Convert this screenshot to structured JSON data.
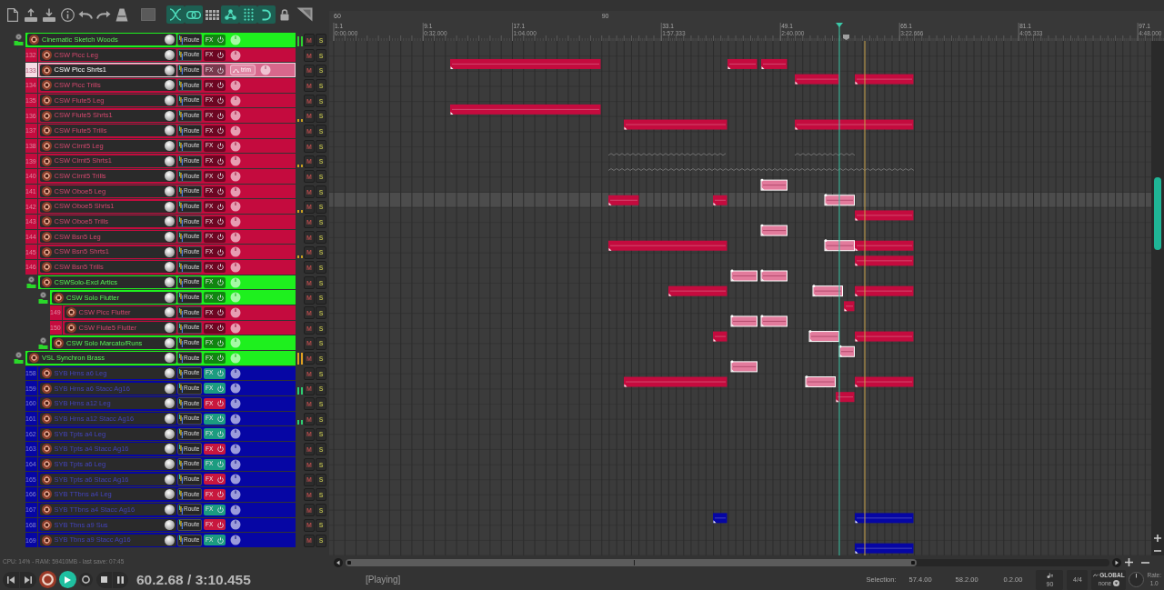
{
  "toolbar": {
    "toggles": [
      {
        "on": true
      },
      {
        "on": true
      },
      {
        "on": false
      },
      {
        "on": true
      },
      {
        "on": true
      },
      {
        "on": true
      },
      {
        "on": false
      }
    ]
  },
  "tracks": [
    {
      "kind": "folder",
      "name": "Cinematic Sketch Woods",
      "color": "#1ef01e",
      "selected": false,
      "route": "Route",
      "fx": {
        "label": "FX",
        "kind": "empty"
      },
      "mute": "M",
      "solo": "S",
      "meter": {
        "level": 0.8,
        "color": "#2ed12e"
      },
      "children": [
        {
          "kind": "track",
          "number": "132",
          "name": "CSW Picc Leg",
          "color": "#c40b3e",
          "selected": false,
          "route": "Route",
          "fx": {
            "label": "FX",
            "kind": "empty"
          },
          "mute": "M",
          "solo": "S"
        },
        {
          "kind": "track",
          "number": "133",
          "name": "CSW Picc Shrts1",
          "color": "#d8678c",
          "selected": true,
          "route": "Route",
          "fx": {
            "label": "FX",
            "kind": "empty"
          },
          "trim": "trim",
          "mute": "M",
          "solo": "S"
        },
        {
          "kind": "track",
          "number": "134",
          "name": "CSW Picc Trills",
          "color": "#c40b3e",
          "selected": false,
          "route": "Route",
          "fx": {
            "label": "FX",
            "kind": "empty"
          },
          "mute": "M",
          "solo": "S"
        },
        {
          "kind": "track",
          "number": "135",
          "name": "CSW Flute5 Leg",
          "color": "#c40b3e",
          "selected": false,
          "route": "Route",
          "fx": {
            "label": "FX",
            "kind": "empty"
          },
          "mute": "M",
          "solo": "S"
        },
        {
          "kind": "track",
          "number": "136",
          "name": "CSW Flute5 Shrts1",
          "color": "#c40b3e",
          "selected": false,
          "route": "Route",
          "fx": {
            "label": "FX",
            "kind": "empty"
          },
          "mute": "M",
          "solo": "S",
          "meter": {
            "level": 0.25,
            "color": "#c8a020"
          }
        },
        {
          "kind": "track",
          "number": "137",
          "name": "CSW Flute5 Trills",
          "color": "#c40b3e",
          "selected": false,
          "route": "Route",
          "fx": {
            "label": "FX",
            "kind": "empty"
          },
          "mute": "M",
          "solo": "S"
        },
        {
          "kind": "track",
          "number": "138",
          "name": "CSW Clrnt5 Leg",
          "color": "#c40b3e",
          "selected": false,
          "route": "Route",
          "fx": {
            "label": "FX",
            "kind": "empty"
          },
          "mute": "M",
          "solo": "S"
        },
        {
          "kind": "track",
          "number": "139",
          "name": "CSW Clrnt5 Shrts1",
          "color": "#c40b3e",
          "selected": false,
          "route": "Route",
          "fx": {
            "label": "FX",
            "kind": "empty"
          },
          "mute": "M",
          "solo": "S",
          "meter": {
            "level": 0.25,
            "color": "#c8a020"
          }
        },
        {
          "kind": "track",
          "number": "140",
          "name": "CSW Clrnt5 Trills",
          "color": "#c40b3e",
          "selected": false,
          "route": "Route",
          "fx": {
            "label": "FX",
            "kind": "empty"
          },
          "mute": "M",
          "solo": "S"
        },
        {
          "kind": "track",
          "number": "141",
          "name": "CSW Oboe5 Leg",
          "color": "#c40b3e",
          "selected": false,
          "route": "Route",
          "fx": {
            "label": "FX",
            "kind": "empty"
          },
          "mute": "M",
          "solo": "S"
        },
        {
          "kind": "track",
          "number": "142",
          "name": "CSW Oboe5 Shrts1",
          "color": "#c40b3e",
          "selected": false,
          "route": "Route",
          "fx": {
            "label": "FX",
            "kind": "empty"
          },
          "mute": "M",
          "solo": "S",
          "meter": {
            "level": 0.25,
            "color": "#c8a020"
          }
        },
        {
          "kind": "track",
          "number": "143",
          "name": "CSW Oboe5 Trills",
          "color": "#c40b3e",
          "selected": false,
          "route": "Route",
          "fx": {
            "label": "FX",
            "kind": "empty"
          },
          "mute": "M",
          "solo": "S"
        },
        {
          "kind": "track",
          "number": "144",
          "name": "CSW Bsn5 Leg",
          "color": "#c40b3e",
          "selected": false,
          "route": "Route",
          "fx": {
            "label": "FX",
            "kind": "empty"
          },
          "mute": "M",
          "solo": "S"
        },
        {
          "kind": "track",
          "number": "145",
          "name": "CSW Bsn5 Shrts1",
          "color": "#c40b3e",
          "selected": false,
          "route": "Route",
          "fx": {
            "label": "FX",
            "kind": "empty"
          },
          "mute": "M",
          "solo": "S",
          "meter": {
            "level": 0.25,
            "color": "#c8a020"
          }
        },
        {
          "kind": "track",
          "number": "146",
          "name": "CSW Bsn5 Trills",
          "color": "#c40b3e",
          "selected": false,
          "route": "Route",
          "fx": {
            "label": "FX",
            "kind": "empty"
          },
          "mute": "M",
          "solo": "S"
        },
        {
          "kind": "folder",
          "name": "CSWSolo-Excl Artics",
          "color": "#1ef01e",
          "selected": false,
          "route": "Route",
          "fx": {
            "label": "FX",
            "kind": "empty"
          },
          "mute": "M",
          "solo": "S",
          "children": [
            {
              "kind": "folder",
              "name": "CSW Solo Flutter",
              "color": "#1ef01e",
              "selected": false,
              "route": "Route",
              "fx": {
                "label": "FX",
                "kind": "empty"
              },
              "mute": "M",
              "solo": "S",
              "children": [
                {
                  "kind": "track",
                  "number": "149",
                  "name": "CSW Picc Flutter",
                  "color": "#c40b3e",
                  "selected": false,
                  "route": "Route",
                  "fx": {
                    "label": "FX",
                    "kind": "empty"
                  },
                  "mute": "M",
                  "solo": "S"
                },
                {
                  "kind": "track",
                  "number": "150",
                  "name": "CSW Flute5 Flutter",
                  "color": "#c40b3e",
                  "selected": false,
                  "route": "Route",
                  "fx": {
                    "label": "FX",
                    "kind": "empty"
                  },
                  "mute": "M",
                  "solo": "S"
                }
              ]
            },
            {
              "kind": "folder",
              "name": "CSW Solo Marcato/Runs",
              "color": "#1ef01e",
              "selected": false,
              "route": "Route",
              "fx": {
                "label": "FX",
                "kind": "empty"
              },
              "mute": "M",
              "solo": "S"
            }
          ]
        }
      ]
    },
    {
      "kind": "folder",
      "name": "VSL Synchron Brass",
      "color": "#1ef01e",
      "selected": false,
      "route": "Route",
      "fx": {
        "label": "FX",
        "kind": "empty"
      },
      "mute": "M",
      "solo": "S",
      "meter": {
        "level": 0.9,
        "color": "#e0a020"
      },
      "children": [
        {
          "kind": "track",
          "number": "158",
          "name": "SYB Hrns a6 Leg",
          "color": "#0606a4",
          "selected": false,
          "route": "Route",
          "fx": {
            "label": "FX",
            "kind": "active"
          },
          "mute": "M",
          "solo": "S"
        },
        {
          "kind": "track",
          "number": "159",
          "name": "SYB Hrns a6 Stacc Ag16",
          "color": "#0606a4",
          "selected": false,
          "route": "Route",
          "fx": {
            "label": "FX",
            "kind": "active"
          },
          "mute": "M",
          "solo": "S",
          "meter": {
            "level": 0.6,
            "color": "#2ecc71"
          }
        },
        {
          "kind": "track",
          "number": "160",
          "name": "SYB Hrns a12 Leg",
          "color": "#0606a4",
          "selected": false,
          "route": "Route",
          "fx": {
            "label": "FX",
            "kind": "bypassed"
          },
          "mute": "M",
          "solo": "S"
        },
        {
          "kind": "track",
          "number": "161",
          "name": "SYB Hrns a12 Stacc Ag16",
          "color": "#0606a4",
          "selected": false,
          "route": "Route",
          "fx": {
            "label": "FX",
            "kind": "active"
          },
          "mute": "M",
          "solo": "S",
          "meter": {
            "level": 0.4,
            "color": "#2ecc71"
          }
        },
        {
          "kind": "track",
          "number": "162",
          "name": "SYB Tpts a4 Leg",
          "color": "#0606a4",
          "selected": false,
          "route": "Route",
          "fx": {
            "label": "FX",
            "kind": "active"
          },
          "mute": "M",
          "solo": "S"
        },
        {
          "kind": "track",
          "number": "163",
          "name": "SYB Tpts a4 Stacc Ag16",
          "color": "#0606a4",
          "selected": false,
          "route": "Route",
          "fx": {
            "label": "FX",
            "kind": "bypassed"
          },
          "mute": "M",
          "solo": "S"
        },
        {
          "kind": "track",
          "number": "164",
          "name": "SYB Tpts a6 Leg",
          "color": "#0606a4",
          "selected": false,
          "route": "Route",
          "fx": {
            "label": "FX",
            "kind": "active"
          },
          "mute": "M",
          "solo": "S"
        },
        {
          "kind": "track",
          "number": "165",
          "name": "SYB Tpts a6 Stacc Ag16",
          "color": "#0606a4",
          "selected": false,
          "route": "Route",
          "fx": {
            "label": "FX",
            "kind": "bypassed"
          },
          "mute": "M",
          "solo": "S"
        },
        {
          "kind": "track",
          "number": "166",
          "name": "SYB TTbns a4 Leg",
          "color": "#0606a4",
          "selected": false,
          "route": "Route",
          "fx": {
            "label": "FX",
            "kind": "bypassed"
          },
          "mute": "M",
          "solo": "S"
        },
        {
          "kind": "track",
          "number": "167",
          "name": "SYB TTbns a4 Stacc Ag16",
          "color": "#0606a4",
          "selected": false,
          "route": "Route",
          "fx": {
            "label": "FX",
            "kind": "active"
          },
          "mute": "M",
          "solo": "S"
        },
        {
          "kind": "track",
          "number": "168",
          "name": "SYB Tbns a9 Sus",
          "color": "#0606a4",
          "selected": false,
          "route": "Route",
          "fx": {
            "label": "FX",
            "kind": "bypassed"
          },
          "mute": "M",
          "solo": "S"
        },
        {
          "kind": "track",
          "number": "169",
          "name": "SYB Tbns a9 Stacc Ag16",
          "color": "#0606a4",
          "selected": false,
          "route": "Route",
          "fx": {
            "label": "FX",
            "kind": "active"
          },
          "mute": "M",
          "solo": "S"
        }
      ]
    }
  ],
  "status_line": "CPU: 14% - RAM: 59410MB - last save: 07:45",
  "ruler": {
    "tempo_markers": [
      {
        "bpm": "60"
      },
      {
        "bpm": "90"
      }
    ],
    "marks": [
      {
        "bar": "1.1",
        "time": "0:00.000"
      },
      {
        "bar": "9.1",
        "time": "0:32.000"
      },
      {
        "bar": "17.1",
        "time": "1:04.000"
      },
      {
        "bar": "33.1",
        "time": "1:57.333"
      },
      {
        "bar": "49.1",
        "time": "2:40.000"
      },
      {
        "bar": "65.1",
        "time": "3:22.666"
      },
      {
        "bar": "81.1",
        "time": "4:05.333"
      },
      {
        "bar": "97.1",
        "time": "4:48.000"
      }
    ]
  },
  "arrange": {
    "lanes": [
      {
        "selected": false
      },
      {
        "selected": false,
        "clips": [
          {
            "kind": "item",
            "color": "#c40b3e",
            "selected": false
          },
          {
            "kind": "item",
            "color": "#c40b3e",
            "selected": false
          },
          {
            "kind": "item",
            "color": "#c40b3e",
            "selected": false
          }
        ]
      },
      {
        "selected": false,
        "clips": [
          {
            "kind": "item",
            "color": "#c40b3e",
            "selected": false
          },
          {
            "kind": "item",
            "color": "#c40b3e",
            "selected": false
          }
        ]
      },
      {
        "selected": false
      },
      {
        "selected": false,
        "clips": [
          {
            "kind": "item",
            "color": "#c40b3e",
            "selected": false
          }
        ]
      },
      {
        "selected": false,
        "clips": [
          {
            "kind": "item",
            "color": "#c40b3e",
            "selected": false
          },
          {
            "kind": "item",
            "color": "#c40b3e",
            "selected": false
          }
        ]
      },
      {
        "selected": false
      },
      {
        "selected": false,
        "clips": [
          {
            "kind": "ghost"
          },
          {
            "kind": "ghost"
          }
        ]
      },
      {
        "selected": false,
        "clips": [
          {
            "kind": "ghost"
          }
        ]
      },
      {
        "selected": false,
        "clips": [
          {
            "kind": "item",
            "color": "#e27b9c",
            "selected": true
          }
        ]
      },
      {
        "selected": true,
        "clips": [
          {
            "kind": "item",
            "color": "#c40b3e",
            "selected": false
          },
          {
            "kind": "item",
            "color": "#c40b3e",
            "selected": false
          },
          {
            "kind": "item",
            "color": "#e27b9c",
            "selected": true
          }
        ]
      },
      {
        "selected": false,
        "clips": [
          {
            "kind": "item",
            "color": "#c40b3e",
            "selected": false
          }
        ]
      },
      {
        "selected": false,
        "clips": [
          {
            "kind": "item",
            "color": "#e27b9c",
            "selected": true
          }
        ]
      },
      {
        "selected": false,
        "clips": [
          {
            "kind": "item",
            "color": "#c40b3e",
            "selected": false
          },
          {
            "kind": "item",
            "color": "#e27b9c",
            "selected": true
          },
          {
            "kind": "item",
            "color": "#c40b3e",
            "selected": false
          }
        ]
      },
      {
        "selected": false,
        "clips": [
          {
            "kind": "item",
            "color": "#c40b3e",
            "selected": false
          }
        ]
      },
      {
        "selected": false,
        "clips": [
          {
            "kind": "item",
            "color": "#e27b9c",
            "selected": true
          },
          {
            "kind": "item",
            "color": "#e27b9c",
            "selected": true
          }
        ]
      },
      {
        "selected": false,
        "clips": [
          {
            "kind": "item",
            "color": "#c40b3e",
            "selected": false
          },
          {
            "kind": "item",
            "color": "#e27b9c",
            "selected": true
          },
          {
            "kind": "item",
            "color": "#c40b3e",
            "selected": false
          }
        ]
      },
      {
        "selected": false,
        "clips": [
          {
            "kind": "item",
            "color": "#c40b3e",
            "selected": false
          }
        ]
      },
      {
        "selected": false,
        "clips": [
          {
            "kind": "item",
            "color": "#e27b9c",
            "selected": true
          },
          {
            "kind": "item",
            "color": "#e27b9c",
            "selected": true
          }
        ]
      },
      {
        "selected": false,
        "clips": [
          {
            "kind": "item",
            "color": "#c40b3e",
            "selected": false
          },
          {
            "kind": "item",
            "color": "#e27b9c",
            "selected": true
          },
          {
            "kind": "item",
            "color": "#c40b3e",
            "selected": false
          }
        ]
      },
      {
        "selected": false,
        "clips": [
          {
            "kind": "item",
            "color": "#e27b9c",
            "selected": true
          }
        ]
      },
      {
        "selected": false,
        "clips": [
          {
            "kind": "item",
            "color": "#e27b9c",
            "selected": true
          }
        ]
      },
      {
        "selected": false,
        "clips": [
          {
            "kind": "item",
            "color": "#c40b3e",
            "selected": false
          },
          {
            "kind": "item",
            "color": "#e27b9c",
            "selected": true
          },
          {
            "kind": "item",
            "color": "#c40b3e",
            "selected": false
          }
        ]
      },
      {
        "selected": false,
        "clips": [
          {
            "kind": "item",
            "color": "#c40b3e",
            "selected": false
          }
        ]
      },
      {
        "selected": false
      },
      {
        "selected": false
      },
      {
        "selected": false
      },
      {
        "selected": false
      },
      {
        "selected": false
      },
      {
        "selected": false
      },
      {
        "selected": false
      },
      {
        "selected": false,
        "clips": [
          {
            "kind": "item",
            "color": "#0606a4",
            "selected": false
          },
          {
            "kind": "item",
            "color": "#0606a4",
            "selected": false
          }
        ]
      },
      {
        "selected": false
      },
      {
        "selected": false,
        "clips": [
          {
            "kind": "item",
            "color": "#0606a4",
            "selected": false
          }
        ]
      }
    ]
  },
  "transport": {
    "recording": false,
    "playing": true,
    "repeat": false,
    "time": "60.2.68 / 3:10.455"
  },
  "status_bar": {
    "state": "[Playing]",
    "selection_label": "Selection:",
    "selection_start": "57.4.00",
    "selection_end": "58.2.00",
    "selection_length": "0.2.00",
    "tempo": "90",
    "time_signature": "4/4",
    "automation_label": "GLOBAL",
    "automation_mode": "none",
    "rate_label": "Rate:",
    "rate": "1.0"
  }
}
